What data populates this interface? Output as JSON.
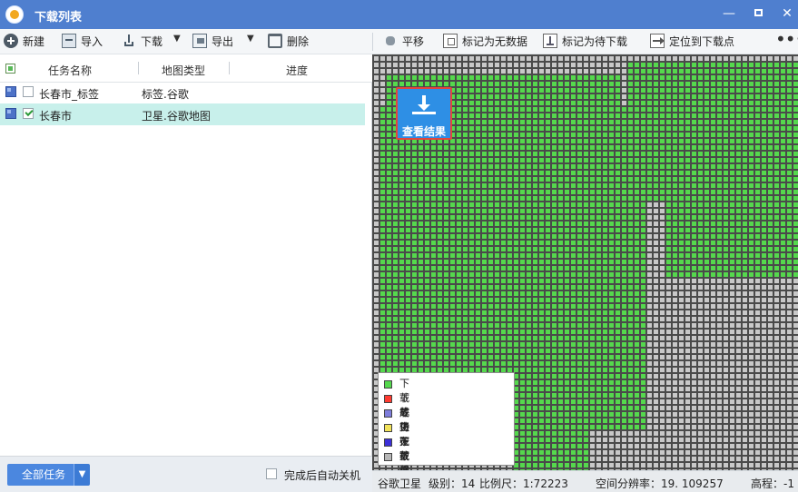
{
  "window": {
    "title": "下载列表"
  },
  "toolbar": {
    "new": "新建",
    "import": "导入",
    "download": "下载",
    "export": "导出",
    "delete": "删除",
    "pan": "平移",
    "mark_no_data": "标记为无数据",
    "mark_pending": "标记为待下载",
    "locate_download_point": "定位到下载点"
  },
  "task_table": {
    "columns": [
      "任务名称",
      "地图类型",
      "进度"
    ],
    "rows": [
      {
        "name": "长春市_标签",
        "type": "标签.谷歌",
        "checked": false,
        "selected": false
      },
      {
        "name": "长春市",
        "type": "卫星.谷歌地图",
        "checked": true,
        "selected": true
      }
    ]
  },
  "bottom": {
    "all_tasks": "全部任务",
    "auto_shutdown": "完成后自动关机"
  },
  "map": {
    "result_button": "查看结果",
    "colors": {
      "success": "#55d84d",
      "failed": "#ff3b30",
      "waiting": "#7e7ddc",
      "downloading": "#f2e35a",
      "no_data": "#3c2fd9",
      "filtered": "#b7b7b7",
      "grid": "#4a4a4a",
      "pending_cell": "#c8c8c8"
    },
    "legend": [
      {
        "label": "下载成功",
        "color": "#55d84d"
      },
      {
        "label": "下载失败",
        "color": "#ff3b30"
      },
      {
        "label": "等待下载",
        "color": "#7e7ddc"
      },
      {
        "label": "正在下载",
        "color": "#f2e35a"
      },
      {
        "label": "无数据",
        "color": "#3c2fd9"
      },
      {
        "label": "被过滤",
        "color": "#b7b7b7"
      }
    ],
    "status": {
      "source": "谷歌卫星",
      "level": "级别：14",
      "scale": "比例尺：1:72223",
      "resolution": "空间分辨率：19. 109257",
      "elevation": "高程：-1"
    }
  }
}
